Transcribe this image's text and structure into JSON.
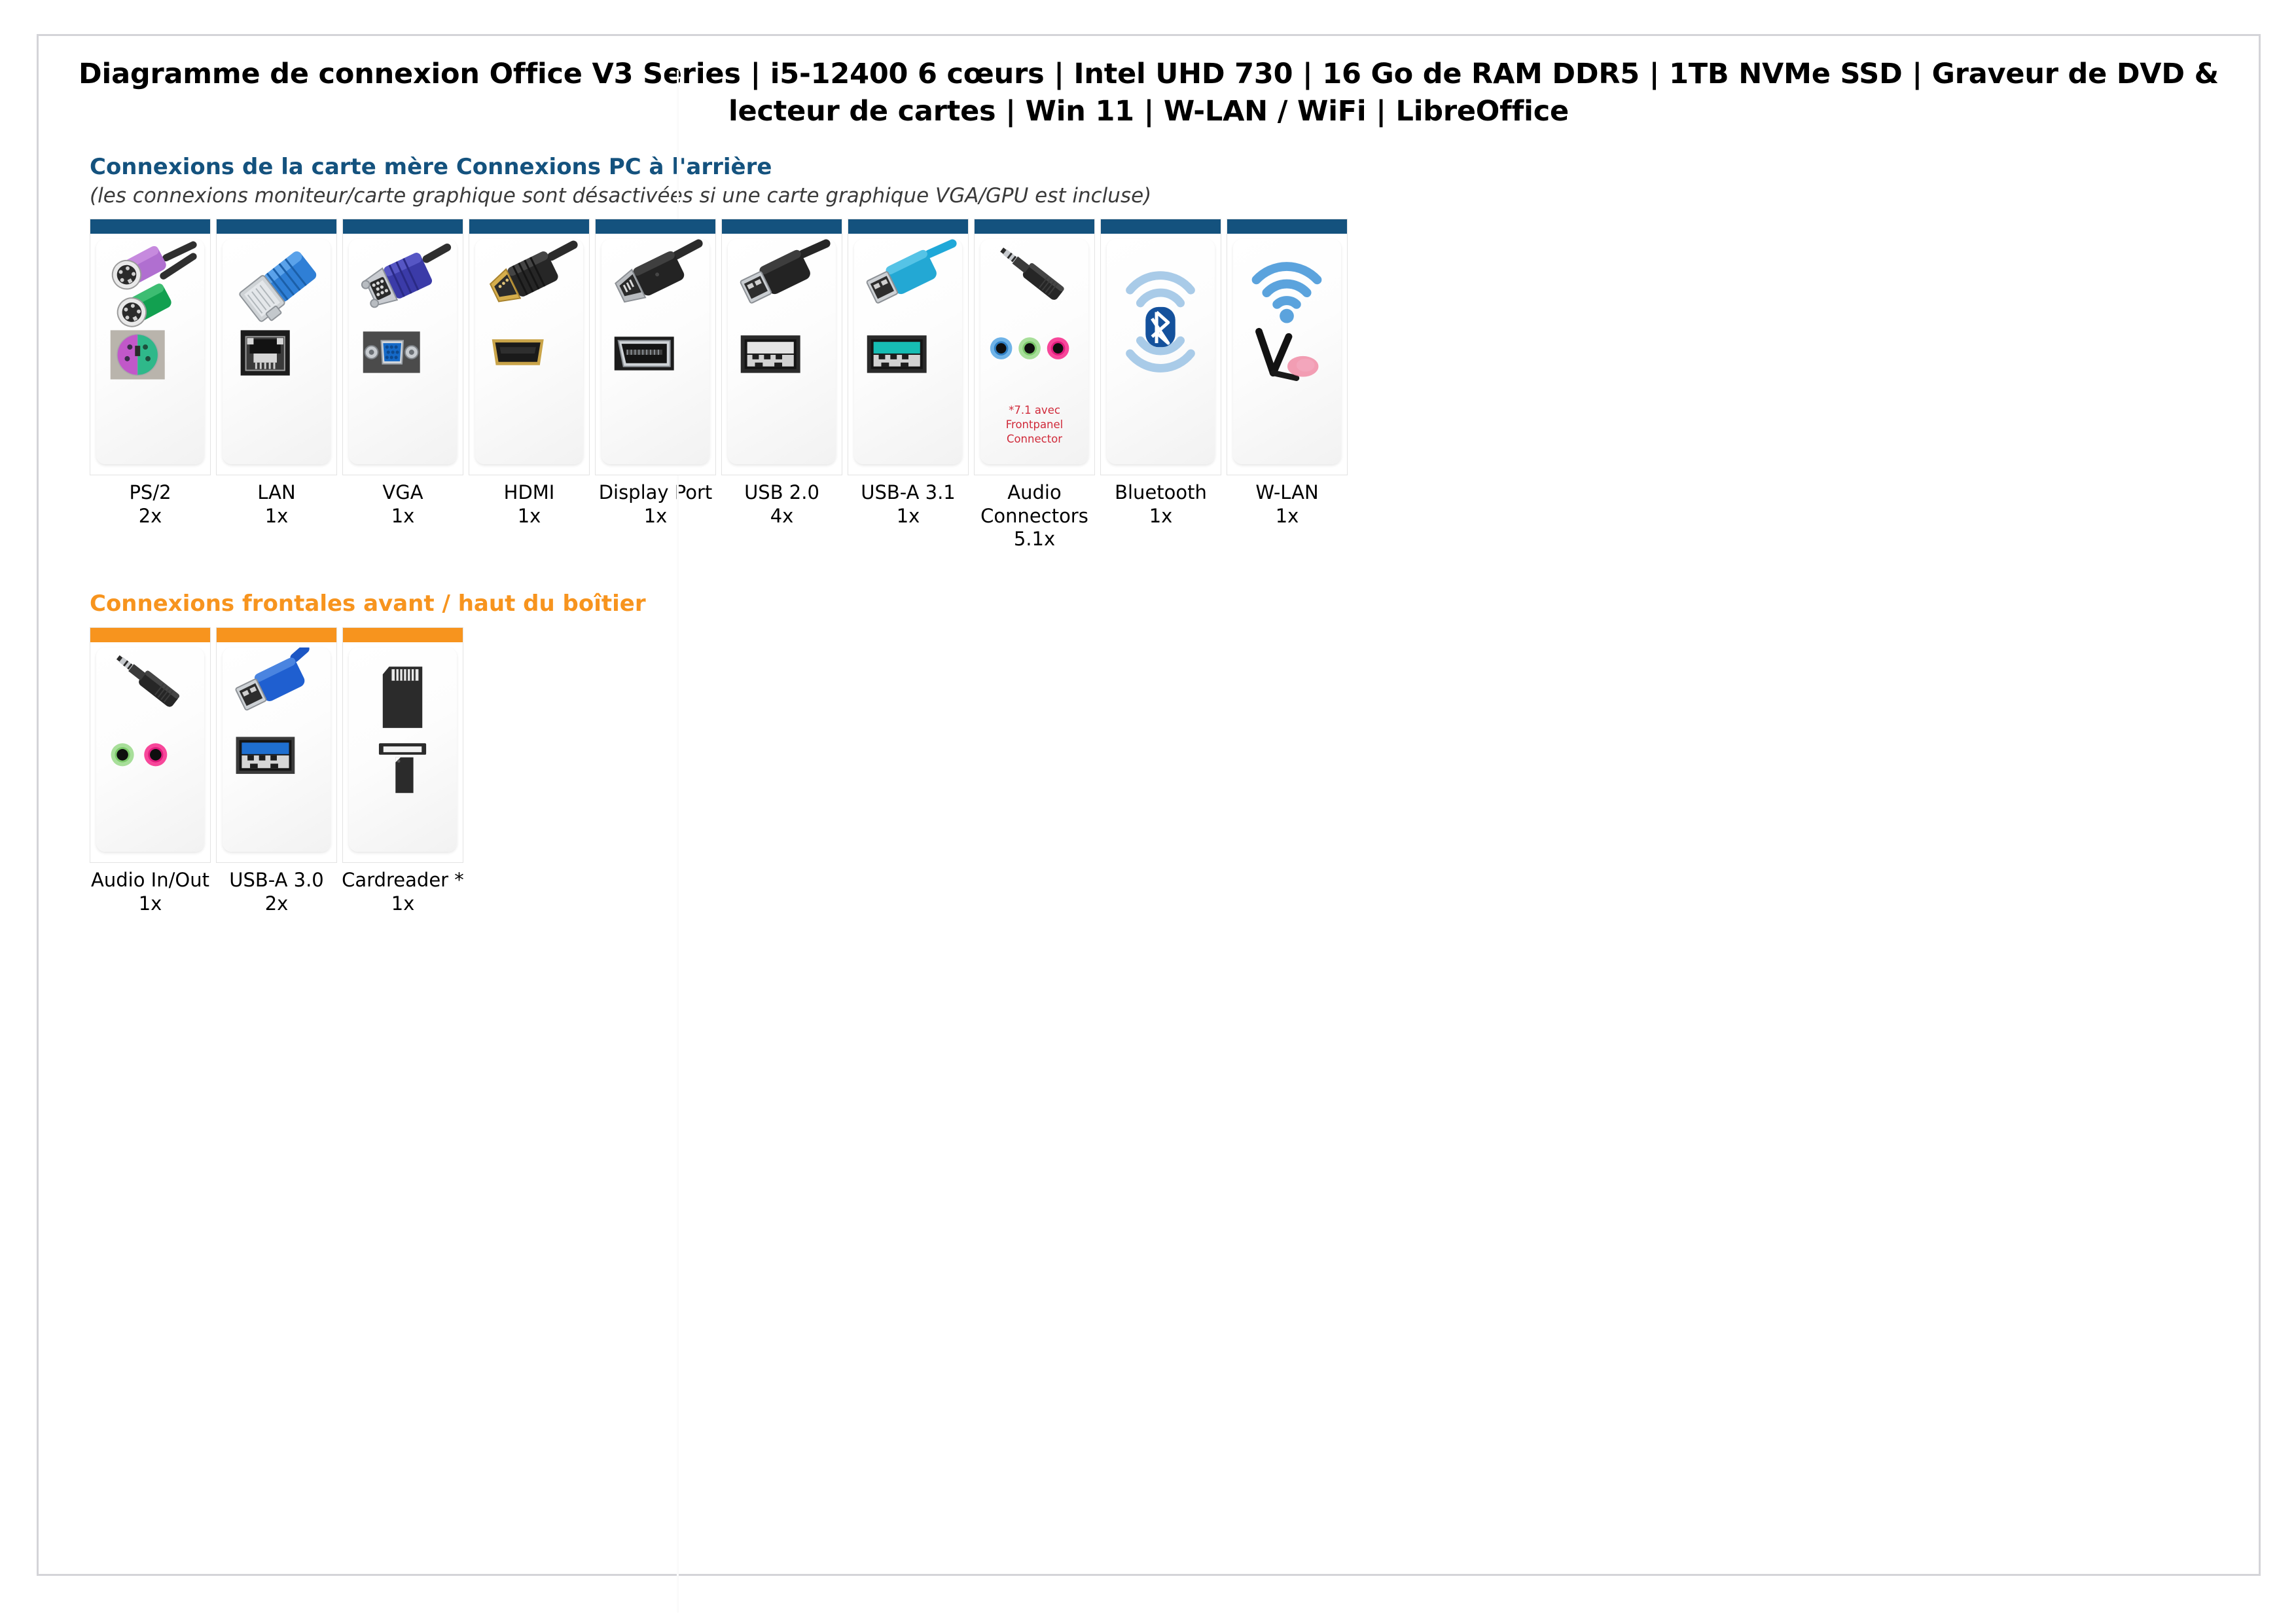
{
  "document": {
    "title": "Diagramme de connexion Office V3 Series | i5-12400 6 cœurs | Intel UHD 730 | 16 Go de RAM DDR5 | 1TB NVMe SSD | Graveur de DVD & lecteur de cartes | Win 11 | W-LAN / WiFi | LibreOffice"
  },
  "colors": {
    "rear_accent": "#14527e",
    "front_accent": "#f7941e",
    "note_red": "#d02a3a",
    "page_border": "#d4d4d8"
  },
  "sections": [
    {
      "id": "rear",
      "heading": "Connexions de la carte mère Connexions PC à l'arrière",
      "subheading": "(les connexions moniteur/carte graphique sont désactivées si une carte graphique VGA/GPU est incluse)",
      "accent": "#14527e",
      "cards": [
        {
          "icon": "ps2-connector-icon",
          "label": "PS/2",
          "qty": "2x",
          "note": ""
        },
        {
          "icon": "lan-rj45-connector-icon",
          "label": "LAN",
          "qty": "1x",
          "note": ""
        },
        {
          "icon": "vga-connector-icon",
          "label": "VGA",
          "qty": "1x",
          "note": ""
        },
        {
          "icon": "hdmi-connector-icon",
          "label": "HDMI",
          "qty": "1x",
          "note": ""
        },
        {
          "icon": "displayport-connector-icon",
          "label": "Display Port",
          "qty": "1x",
          "note": ""
        },
        {
          "icon": "usb2-connector-icon",
          "label": "USB 2.0",
          "qty": "4x",
          "note": ""
        },
        {
          "icon": "usb-a31-connector-icon",
          "label": "USB-A 3.1",
          "qty": "1x",
          "note": ""
        },
        {
          "icon": "audio-jack-connector-icon",
          "label": "Audio Connectors",
          "qty": "5.1x",
          "note": "*7.1 avec Frontpanel Connector"
        },
        {
          "icon": "bluetooth-icon",
          "label": "Bluetooth",
          "qty": "1x",
          "note": ""
        },
        {
          "icon": "wlan-antenna-icon",
          "label": "W-LAN",
          "qty": "1x",
          "note": ""
        }
      ]
    },
    {
      "id": "front",
      "heading": "Connexions frontales avant / haut du boîtier",
      "subheading": "",
      "accent": "#f7941e",
      "cards": [
        {
          "icon": "audio-in-out-icon",
          "label": "Audio In/Out",
          "qty": "1x",
          "note": ""
        },
        {
          "icon": "usb-a30-connector-icon",
          "label": "USB-A 3.0",
          "qty": "2x",
          "note": ""
        },
        {
          "icon": "cardreader-icon",
          "label": "Cardreader *",
          "qty": "1x",
          "note": ""
        }
      ]
    }
  ]
}
